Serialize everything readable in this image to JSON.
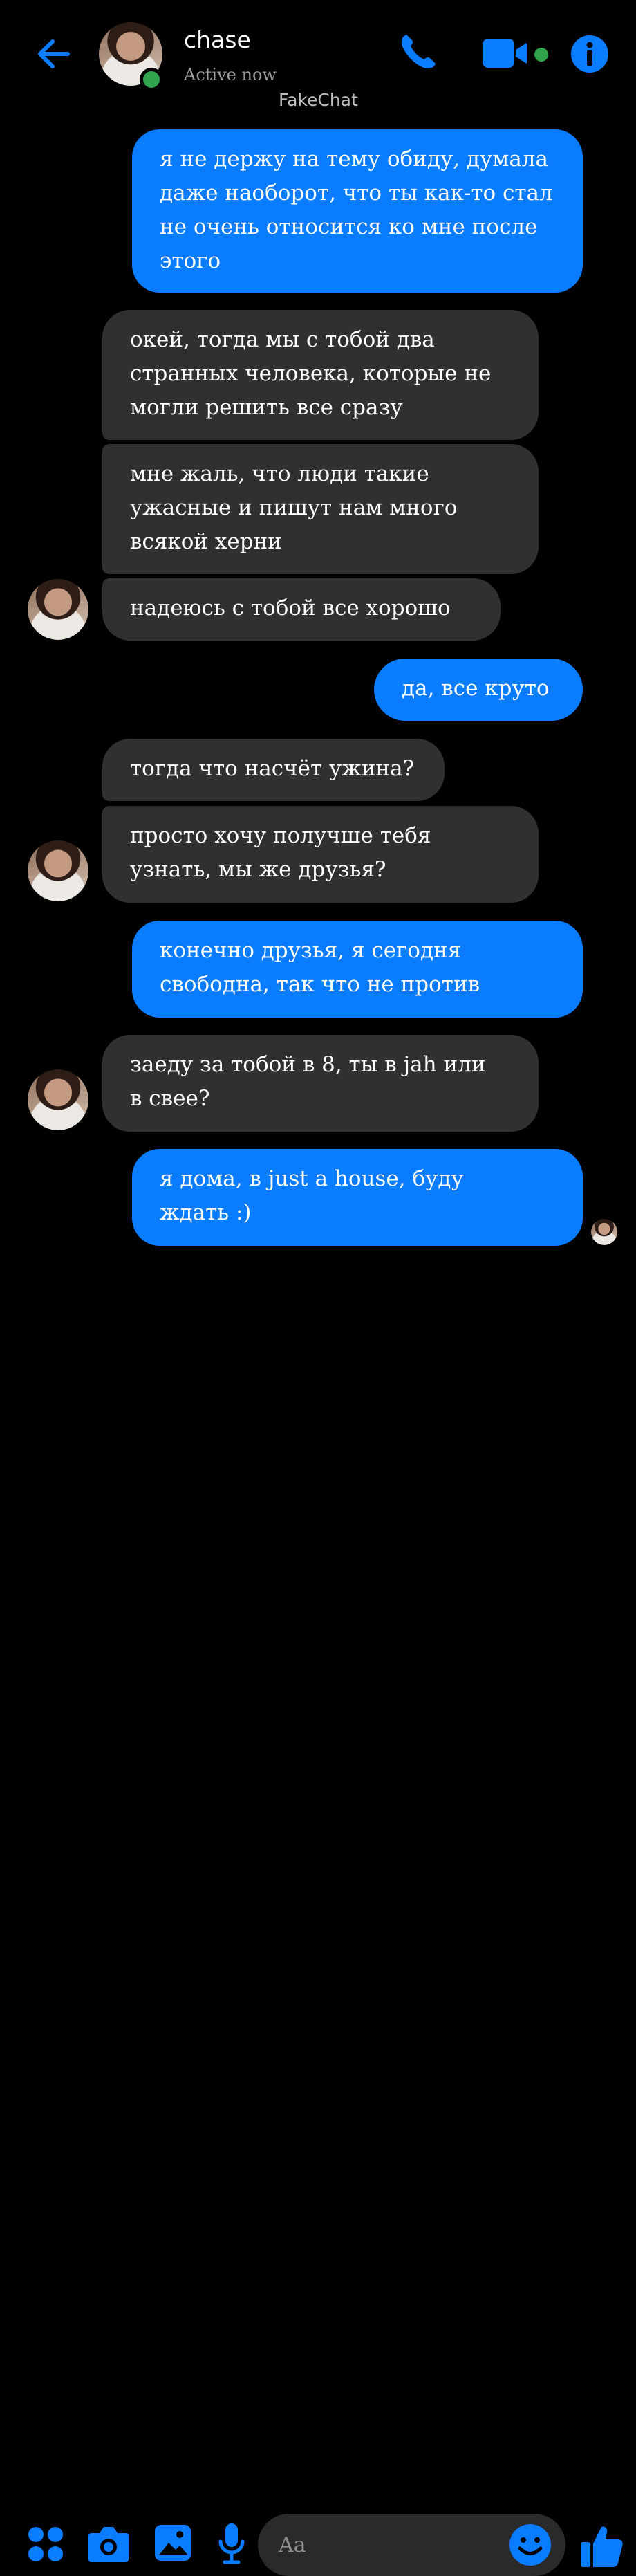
{
  "header": {
    "back_icon": "arrow-left-icon",
    "name": "chase",
    "status": "Active now",
    "brand": "FakeChat",
    "accent": "#0a7cff",
    "online_color": "#31a24c",
    "icons": [
      "phone-icon",
      "video-icon",
      "info-icon"
    ]
  },
  "messages": [
    {
      "from": "me",
      "text": "я не держу на тему обиду, думала\nдаже наоборот, что ты как-то стал\nне очень относится ко мне после\nэтого"
    },
    {
      "from": "chase",
      "text": "окей, тогда мы с тобой два\nстранных человека, которые не\nмогли решить все сразу"
    },
    {
      "from": "chase",
      "text": "мне жаль, что люди такие\nужасные и пишут нам много\nвсякой херни"
    },
    {
      "from": "chase",
      "text": "надеюсь с тобой все хорошо"
    },
    {
      "from": "me",
      "text": "да, все круто"
    },
    {
      "from": "chase",
      "text": "тогда что насчёт ужина?"
    },
    {
      "from": "chase",
      "text": "просто хочу получше тебя\nузнать, мы же друзья?"
    },
    {
      "from": "me",
      "text": "конечно друзья, я сегодня\nсвободна, так что не против"
    },
    {
      "from": "chase",
      "text": "заеду за тобой в 8, ты в jah или\nв свее?"
    },
    {
      "from": "me",
      "text": "я дома, в just a house, буду\nждать :)"
    }
  ],
  "composer": {
    "placeholder": "Aa",
    "icons": [
      "apps-icon",
      "camera-icon",
      "gallery-icon",
      "mic-icon",
      "emoji-icon",
      "thumbs-up-icon"
    ]
  }
}
